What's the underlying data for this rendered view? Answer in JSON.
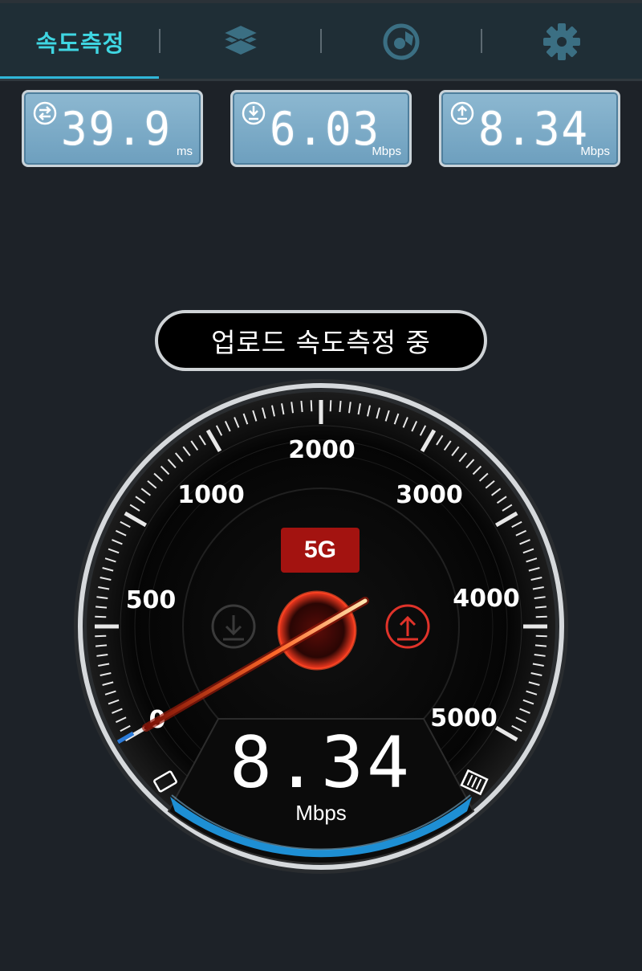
{
  "tabs": [
    {
      "label": "속도측정",
      "icon": "speedometer-tab",
      "active": true
    },
    {
      "label": "",
      "icon": "layers-icon",
      "active": false
    },
    {
      "label": "",
      "icon": "coverage-map-icon",
      "active": false
    },
    {
      "label": "",
      "icon": "gear-icon",
      "active": false
    }
  ],
  "stats": {
    "ping": {
      "value": "39.9",
      "unit": "ms",
      "icon": "ping-exchange-icon"
    },
    "download": {
      "value": "6.03",
      "unit": "Mbps",
      "icon": "download-icon"
    },
    "upload": {
      "value": "8.34",
      "unit": "Mbps",
      "icon": "upload-icon"
    }
  },
  "status_text": "업로드 속도측정 중",
  "gauge": {
    "network": "5G",
    "current_value": "8.34",
    "current_unit": "Mbps",
    "scale_labels": [
      "0",
      "500",
      "1000",
      "2000",
      "3000",
      "4000",
      "5000"
    ],
    "active_direction": "upload",
    "needle_value_mbps": 8.34
  },
  "colors": {
    "accent": "#3fd6e2",
    "stat_box": "#7aabc8",
    "upload_active": "#e0332a",
    "progress_bar": "#1e8fd4",
    "background": "#1d2228"
  }
}
